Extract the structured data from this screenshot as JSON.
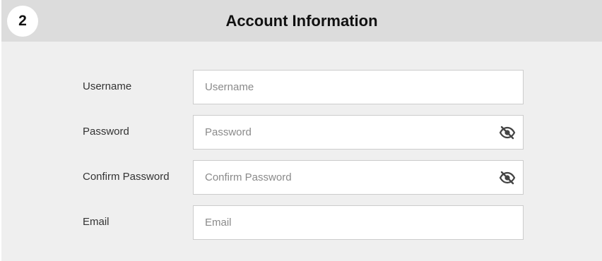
{
  "section": {
    "step_number": "2",
    "title": "Account Information"
  },
  "form": {
    "username": {
      "label": "Username",
      "placeholder": "Username",
      "value": ""
    },
    "password": {
      "label": "Password",
      "placeholder": "Password",
      "value": "",
      "toggle_icon": "eye-slash-icon"
    },
    "confirm_password": {
      "label": "Confirm Password",
      "placeholder": "Confirm Password",
      "value": "",
      "toggle_icon": "eye-slash-icon"
    },
    "email": {
      "label": "Email",
      "placeholder": "Email",
      "value": ""
    }
  },
  "colors": {
    "header_background": "#dcdcdc",
    "panel_background": "#efefef",
    "field_background": "#ffffff",
    "field_border": "#cccccc",
    "placeholder_text": "#8a8a8a",
    "label_text": "#333333",
    "title_text": "#111111"
  }
}
